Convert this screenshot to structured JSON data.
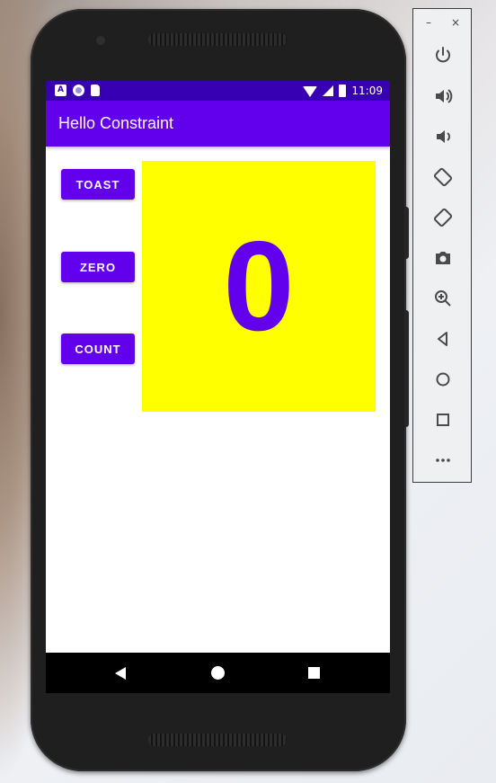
{
  "status_bar": {
    "time": "11:09",
    "notification_a": "A"
  },
  "app_bar": {
    "title": "Hello Constraint"
  },
  "buttons": {
    "toast": "TOAST",
    "zero": "ZERO",
    "count": "COUNT"
  },
  "counter": {
    "value": "0"
  },
  "emulator": {
    "minimize": "–",
    "close": "×",
    "tools": [
      "power-icon",
      "volume-up-icon",
      "volume-down-icon",
      "rotate-left-icon",
      "rotate-right-icon",
      "camera-icon",
      "zoom-icon",
      "back-icon",
      "home-icon",
      "overview-icon",
      "more-icon"
    ]
  },
  "colors": {
    "primary": "#6200ee",
    "primary_dark": "#3700b3",
    "count_bg": "#ffff00"
  }
}
